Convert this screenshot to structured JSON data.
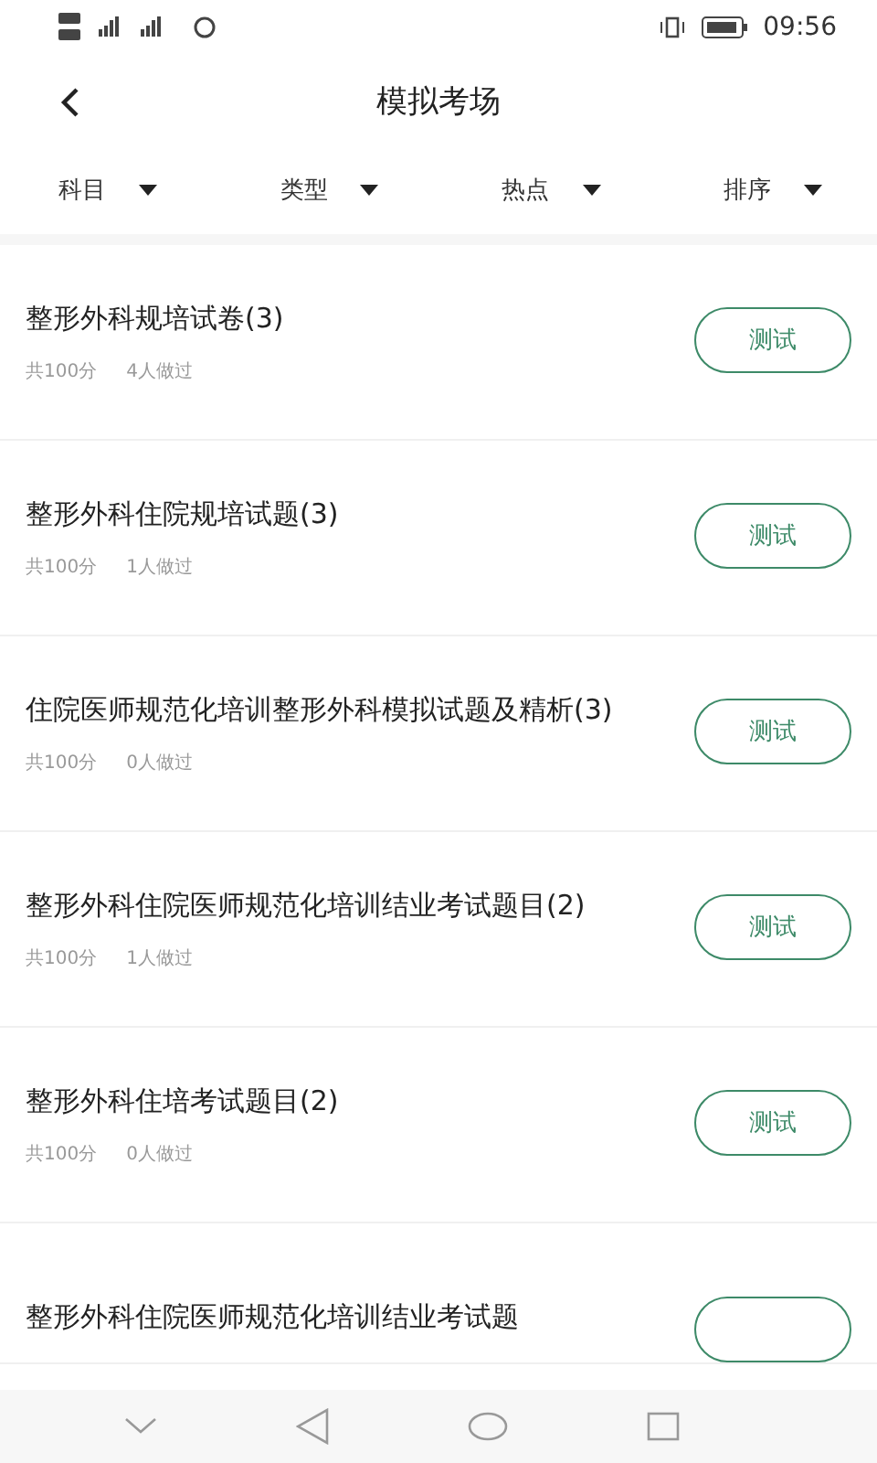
{
  "status_bar": {
    "time": "09:56"
  },
  "header": {
    "title": "模拟考场"
  },
  "filters": [
    {
      "label": "科目"
    },
    {
      "label": "类型"
    },
    {
      "label": "热点"
    },
    {
      "label": "排序"
    }
  ],
  "exams": [
    {
      "kind": "full",
      "title": "整形外科规培试卷(3)",
      "score": "共100分",
      "takers": "4人做过",
      "button": "测试"
    },
    {
      "kind": "full",
      "title": "整形外科住院规培试题(3)",
      "score": "共100分",
      "takers": "1人做过",
      "button": "测试"
    },
    {
      "kind": "full",
      "title": "住院医师规范化培训整形外科模拟试题及精析(3)",
      "score": "共100分",
      "takers": "0人做过",
      "button": "测试"
    },
    {
      "kind": "full",
      "title": "整形外科住院医师规范化培训结业考试题目(2)",
      "score": "共100分",
      "takers": "1人做过",
      "button": "测试"
    },
    {
      "kind": "full",
      "title": "整形外科住培考试题目(2)",
      "score": "共100分",
      "takers": "0人做过",
      "button": "测试"
    },
    {
      "kind": "cut",
      "title": "整形外科住院医师规范化培训结业考试题"
    }
  ]
}
